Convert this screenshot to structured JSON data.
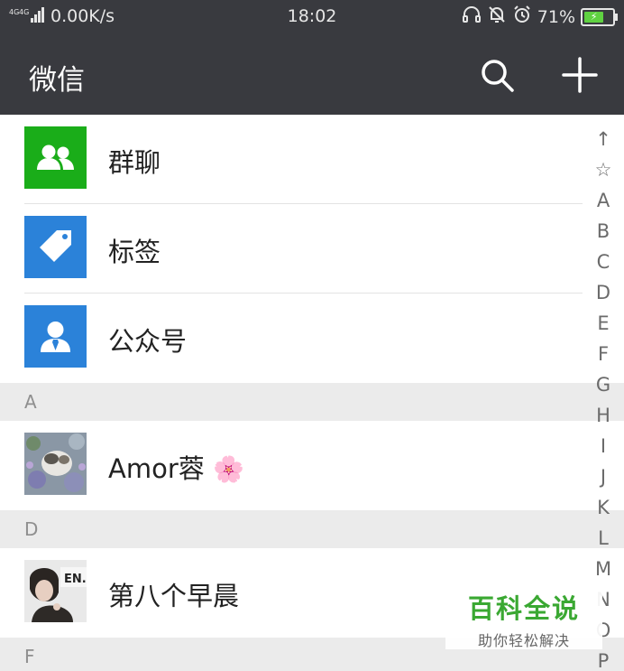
{
  "status_bar": {
    "signal": "4G 4G",
    "speed": "0.00K/s",
    "time": "18:02",
    "battery_percent": "71%",
    "battery_level": 0.71
  },
  "app_bar": {
    "title": "微信",
    "icons": [
      "search-icon",
      "plus-icon"
    ]
  },
  "special_items": [
    {
      "label": "群聊",
      "icon": "group-chat-icon",
      "color": "#1aad19"
    },
    {
      "label": "标签",
      "icon": "tag-icon",
      "color": "#2b82d9"
    },
    {
      "label": "公众号",
      "icon": "official-account-icon",
      "color": "#2b82d9"
    }
  ],
  "sections": [
    {
      "header": "A",
      "contacts": [
        {
          "name": "Amor蓉",
          "emoji": "🌸"
        }
      ]
    },
    {
      "header": "D",
      "contacts": [
        {
          "name": "第八个早晨",
          "emoji": ""
        }
      ]
    },
    {
      "header": "F",
      "contacts": []
    }
  ],
  "index_letters": [
    "↑",
    "☆",
    "A",
    "B",
    "C",
    "D",
    "E",
    "F",
    "G",
    "H",
    "I",
    "J",
    "K",
    "L",
    "M",
    "N",
    "O",
    "P"
  ],
  "watermark": {
    "title": "百科全说",
    "subtitle": "助你轻松解决"
  }
}
